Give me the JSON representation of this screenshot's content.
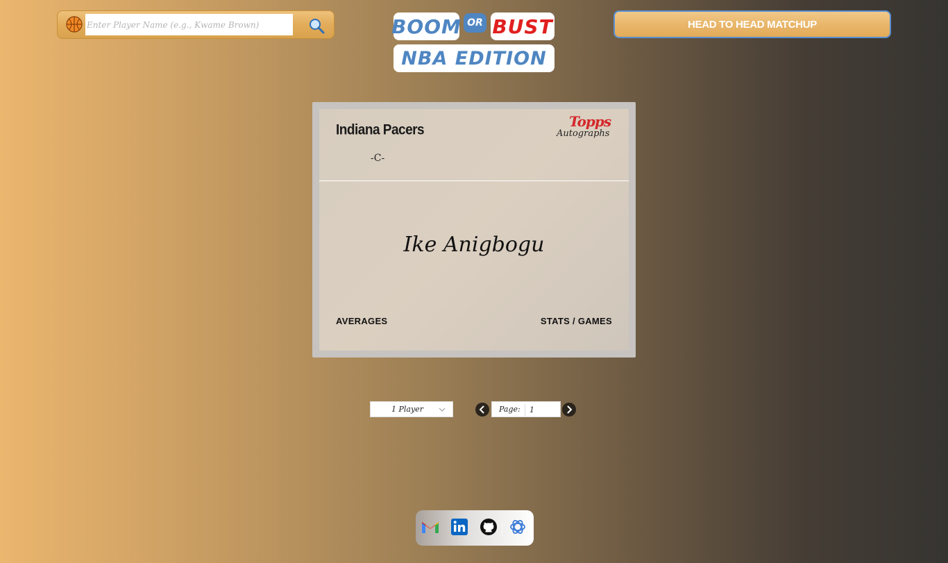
{
  "search": {
    "placeholder": "Enter Player Name (e.g., Kwame Brown)",
    "value": ""
  },
  "logo": {
    "boom": "BOOM",
    "or": "OR",
    "bust": "BUST",
    "edition": "NBA EDITION"
  },
  "header": {
    "h2h_label": "HEAD TO HEAD MATCHUP"
  },
  "card": {
    "team": "Indiana Pacers",
    "position": "-C-",
    "brand": "Topps",
    "brand_sub": "Autographs",
    "player_signature": "Ike Anigbogu",
    "averages_label": "AVERAGES",
    "stats_games_label": "STATS / GAMES"
  },
  "controls": {
    "players_per_page": "1 Player",
    "page_label": "Page:",
    "page_value": "1"
  },
  "colors": {
    "brand_blue": "#4f86c2",
    "bust_red": "#e11f1f",
    "topps_red": "#d4262a"
  },
  "icons": {
    "search": "magnifier-icon",
    "ball": "basketball-icon",
    "prev": "chevron-left-icon",
    "next": "chevron-right-icon",
    "select": "chevron-down-icon",
    "footer": [
      "gmail-icon",
      "linkedin-icon",
      "github-icon",
      "openai-icon"
    ]
  }
}
